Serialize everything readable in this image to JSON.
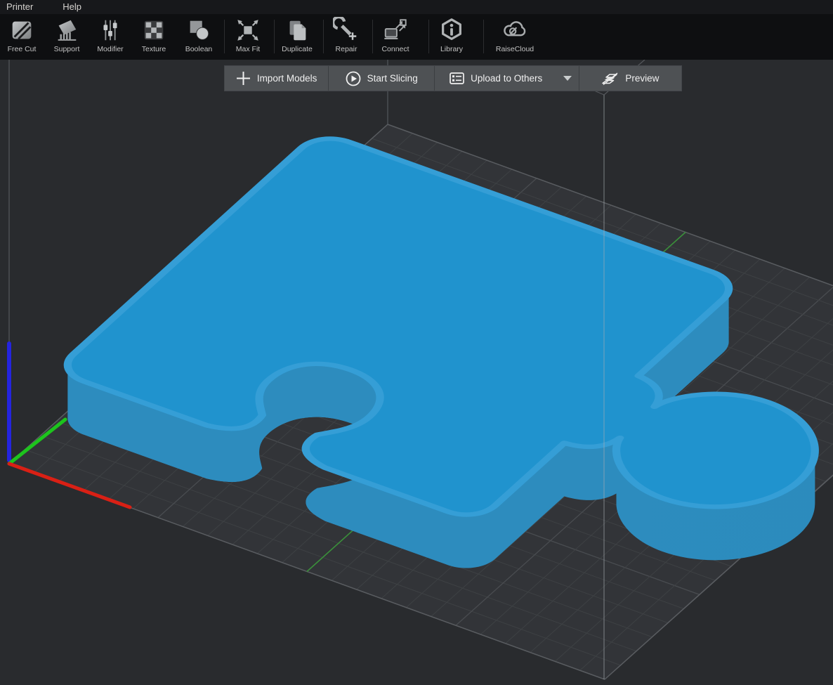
{
  "window": {
    "menu": [
      "Printer",
      "Help"
    ]
  },
  "toolbar": {
    "items": [
      {
        "label": "Free Cut"
      },
      {
        "label": "Support"
      },
      {
        "label": "Modifier"
      },
      {
        "label": "Texture"
      },
      {
        "label": "Boolean"
      },
      {
        "label": "Max Fit"
      },
      {
        "label": "Duplicate"
      },
      {
        "label": "Repair"
      },
      {
        "label": "Connect"
      },
      {
        "label": "Library"
      },
      {
        "label": "RaiseCloud"
      }
    ]
  },
  "action_bar": {
    "import_label": "Import Models",
    "slice_label": "Start Slicing",
    "upload_label": "Upload to Others",
    "preview_label": "Preview"
  },
  "scene": {
    "model_name": "puzzle-piece",
    "colors": {
      "viewport_bg": "#292b2e",
      "plate_fill": "#323438",
      "grid_minor": "#3e4144",
      "grid_major": "#494c50",
      "plate_edge": "#595c60",
      "volume_wire": "#55585c",
      "center_line_green": "#3a8f3a",
      "model_top": "#2093ce",
      "model_edge_highlight": "#359ed6",
      "model_wall_light": "#2d8cbe",
      "model_wall_mid": "#2181b1",
      "model_wall_dark": "#1a6994",
      "axis_x": "#d92015",
      "axis_y": "#1dc41d",
      "axis_z": "#2424df"
    }
  }
}
